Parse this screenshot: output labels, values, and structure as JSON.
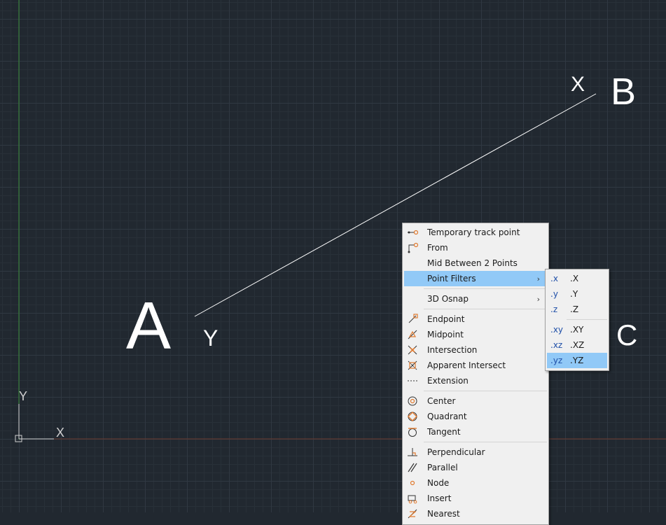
{
  "canvas": {
    "labels": {
      "point_a": "A",
      "point_b": "B",
      "point_c": "C",
      "x_near_b": "X",
      "y_near_a": "Y"
    },
    "ucs": {
      "x_label": "X",
      "y_label": "Y"
    }
  },
  "context_menu": {
    "items": [
      {
        "label": "Temporary track point",
        "icon": "temporary-track-icon"
      },
      {
        "label": "From",
        "icon": "from-icon"
      },
      {
        "label": "Mid Between 2 Points",
        "icon": ""
      },
      {
        "label": "Point Filters",
        "icon": "",
        "submenu": true,
        "highlighted": true
      },
      {
        "label": "3D Osnap",
        "icon": "",
        "submenu": true
      },
      {
        "label": "Endpoint",
        "icon": "endpoint-icon"
      },
      {
        "label": "Midpoint",
        "icon": "midpoint-icon"
      },
      {
        "label": "Intersection",
        "icon": "intersection-icon"
      },
      {
        "label": "Apparent Intersect",
        "icon": "apparent-intersect-icon"
      },
      {
        "label": "Extension",
        "icon": "extension-icon"
      },
      {
        "label": "Center",
        "icon": "center-icon"
      },
      {
        "label": "Quadrant",
        "icon": "quadrant-icon"
      },
      {
        "label": "Tangent",
        "icon": "tangent-icon"
      },
      {
        "label": "Perpendicular",
        "icon": "perpendicular-icon"
      },
      {
        "label": "Parallel",
        "icon": "parallel-icon"
      },
      {
        "label": "Node",
        "icon": "node-icon"
      },
      {
        "label": "Insert",
        "icon": "insert-icon"
      },
      {
        "label": "Nearest",
        "icon": "nearest-icon"
      }
    ],
    "submenu_arrow": "›"
  },
  "point_filters_submenu": {
    "items": [
      {
        "short": ".x",
        "label": ".X"
      },
      {
        "short": ".y",
        "label": ".Y"
      },
      {
        "short": ".z",
        "label": ".Z"
      },
      {
        "short": ".xy",
        "label": ".XY"
      },
      {
        "short": ".xz",
        "label": ".XZ"
      },
      {
        "short": ".yz",
        "label": ".YZ",
        "highlighted": true
      }
    ]
  },
  "colors": {
    "background": "#212830",
    "menu_highlight": "#91c9f7",
    "icon_accent": "#e07a2f",
    "y_axis": "#3a8c3a",
    "x_axis": "#6b3a2e"
  }
}
